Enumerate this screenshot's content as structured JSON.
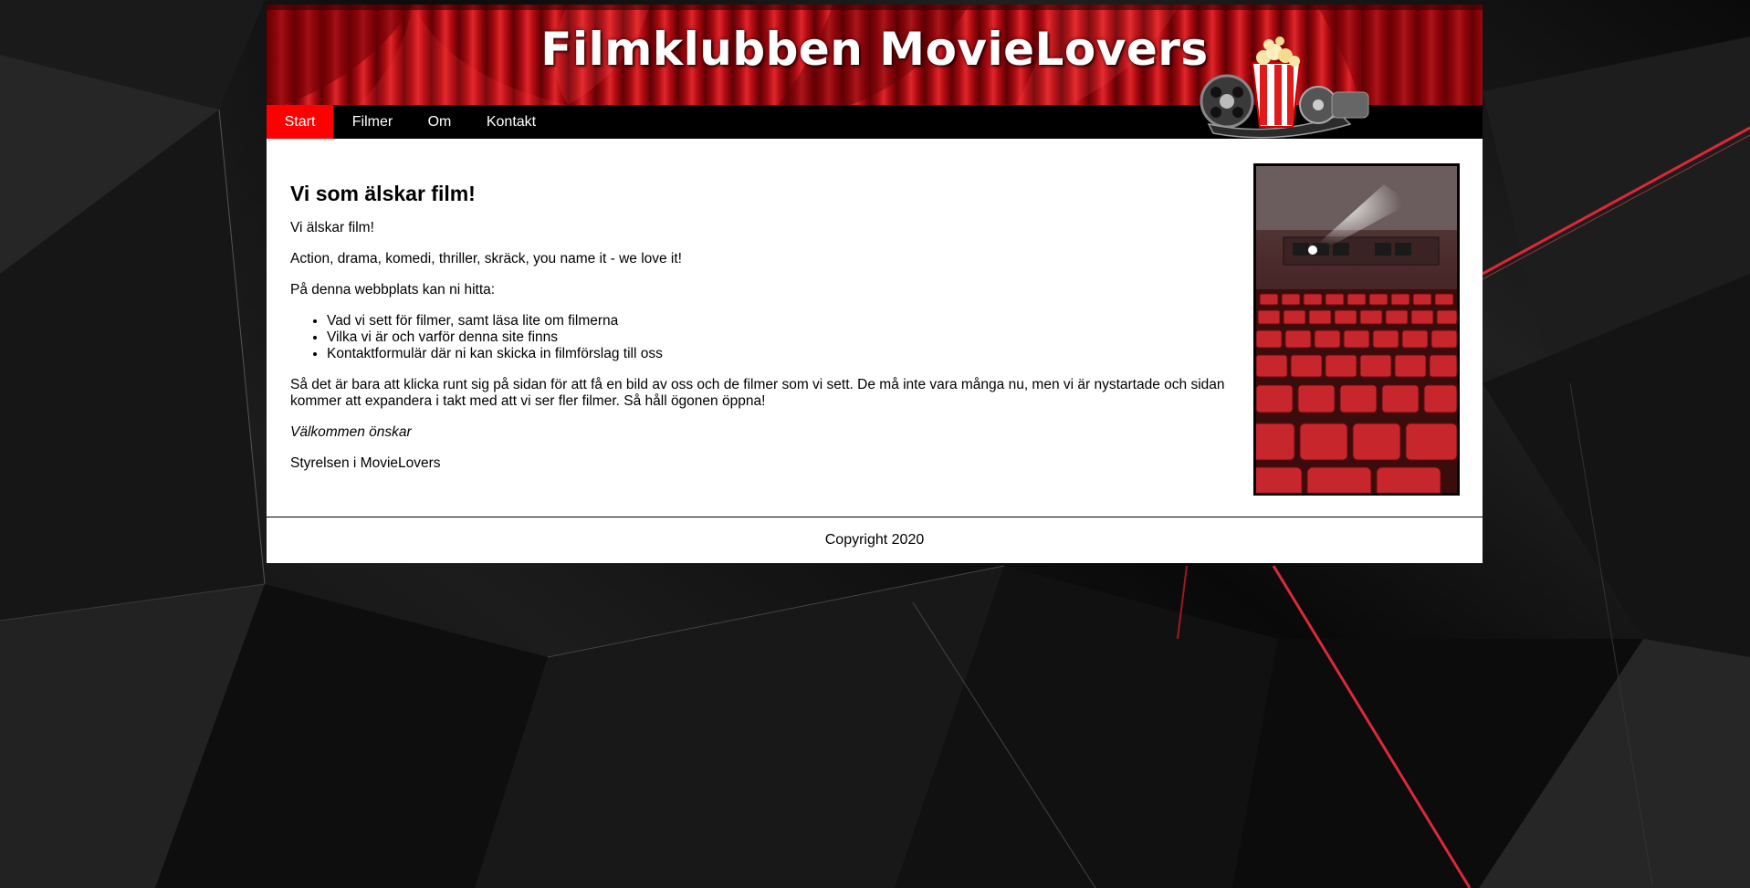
{
  "site": {
    "title": "Filmklubben MovieLovers"
  },
  "nav": {
    "items": [
      {
        "label": "Start",
        "active": true
      },
      {
        "label": "Filmer",
        "active": false
      },
      {
        "label": "Om",
        "active": false
      },
      {
        "label": "Kontakt",
        "active": false
      }
    ]
  },
  "main": {
    "heading": "Vi som älskar film!",
    "intro": "Vi älskar film!",
    "genres": "Action, drama, komedi, thriller, skräck, you name it - we love it!",
    "list_intro": "På denna webbplats kan ni hitta:",
    "list": [
      "Vad vi sett för filmer, samt läsa lite om filmerna",
      "Vilka vi är och varför denna site finns",
      "Kontaktformulär där ni kan skicka in filmförslag till oss"
    ],
    "body": "Så det är bara att klicka runt sig på sidan för att få en bild av oss och de filmer som vi sett. De må inte vara många nu, men vi är nystartade och sidan kommer att expandera i takt med att vi ser fler filmer. Så håll ögonen öppna!",
    "greeting": "Välkommen önskar",
    "signature": "Styrelsen i MovieLovers"
  },
  "footer": {
    "copyright": "Copyright 2020"
  },
  "colors": {
    "accent": "#ff0000",
    "nav_bg": "#000000",
    "curtain": "#c4161c"
  },
  "icons": {
    "banner_decoration": "film-reel-popcorn-icon",
    "side_image": "cinema-seats-image"
  }
}
